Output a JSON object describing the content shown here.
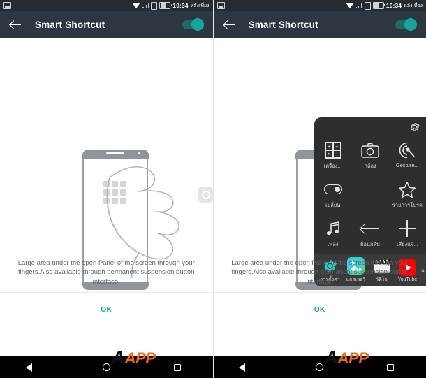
{
  "status_bar": {
    "notification_icon": "screenshot-icon",
    "icons": [
      "wifi-icon",
      "signal-icon",
      "sim-icon",
      "battery-icon"
    ],
    "time": "10:34",
    "period": "หลังเที่ยง"
  },
  "app_bar": {
    "back_icon": "back-arrow-icon",
    "title": "Smart Shortcut",
    "toggle_state": "on",
    "toggle_color": "#17a49a"
  },
  "illustration": {
    "phone_label": "phone-outline",
    "grid_label": "app-grid",
    "hand_label": "hand-pointing",
    "float_button_label": "floating-button"
  },
  "panel": {
    "gear_icon": "gear-icon",
    "items": [
      {
        "icon": "calculator-icon",
        "label": "เครื่อง..."
      },
      {
        "icon": "camera-icon",
        "label": "กล้อง"
      },
      {
        "icon": "gesture-icon",
        "label": "Gesture..."
      },
      {
        "icon": "toggle-icon",
        "label": "เปลี่ยน"
      },
      {
        "icon": "blank-icon",
        "label": ""
      },
      {
        "icon": "star-icon",
        "label": "รายการโปรด"
      },
      {
        "icon": "music-note-icon",
        "label": "เพลง"
      },
      {
        "icon": "back-arrow-icon",
        "label": "ย้อนกลับ"
      },
      {
        "icon": "plus-icon",
        "label": "เสียงแจ..."
      }
    ],
    "dock": [
      {
        "icon": "settings-gear-icon",
        "label": "การตั้งค่า"
      },
      {
        "icon": "gallery-icon",
        "label": "แกลเลอรี"
      },
      {
        "icon": "video-clapper-icon",
        "label": "วิดีโอ"
      },
      {
        "icon": "youtube-icon",
        "label": "YouTube"
      }
    ],
    "dock_more": "แ"
  },
  "footer": {
    "description": "Large area under the open Panel of the screen through your fingers.Also available through permanent suspension button interface.",
    "ok_label": "OK",
    "ok_color": "#12a89d"
  },
  "nav_bar": {
    "back": "nav-back-icon",
    "home": "nav-home-icon",
    "recents": "nav-recents-icon"
  },
  "watermark": {
    "letter": "A",
    "text": "APP",
    "color": "#ef6a14"
  }
}
